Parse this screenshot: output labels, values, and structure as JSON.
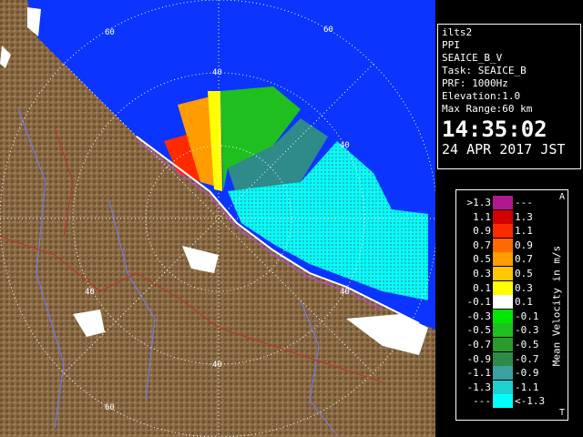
{
  "info": {
    "station": "ilts2",
    "mode": "PPI",
    "product": "SEAICE_B_V",
    "task": "Task: SEAICE_B",
    "prf": "PRF: 1000Hz",
    "elevation": "Elevation:1.0",
    "max_range": "Max Range:60 km",
    "time": "14:35:02",
    "date": "24 APR 2017 JST"
  },
  "range_labels": {
    "r60_top": "60",
    "r40_top": "40",
    "r40_right": "40",
    "r40_left": "40",
    "r40_bottom": "40",
    "r60_bottom": "60",
    "r40_lower_right": "40"
  },
  "legend": {
    "title": "Mean Velocity in m/s",
    "caret_top": "A",
    "caret_bottom": "T",
    "rows": [
      {
        "left": ">1.3",
        "right": "---",
        "color": "#b0188f"
      },
      {
        "left": "1.1",
        "right": "1.3",
        "color": "#d40000"
      },
      {
        "left": "0.9",
        "right": "1.1",
        "color": "#ff2a00"
      },
      {
        "left": "0.7",
        "right": "0.9",
        "color": "#ff6a00"
      },
      {
        "left": "0.5",
        "right": "0.7",
        "color": "#ff9c00"
      },
      {
        "left": "0.3",
        "right": "0.5",
        "color": "#ffc800"
      },
      {
        "left": "0.1",
        "right": "0.3",
        "color": "#ffff00"
      },
      {
        "left": "-0.1",
        "right": "0.1",
        "color": "#ffffff"
      },
      {
        "left": "-0.3",
        "right": "-0.1",
        "color": "#00e600"
      },
      {
        "left": "-0.5",
        "right": "-0.3",
        "color": "#1fbf1f"
      },
      {
        "left": "-0.7",
        "right": "-0.5",
        "color": "#2a9a2a"
      },
      {
        "left": "-0.9",
        "right": "-0.7",
        "color": "#2f8a4a"
      },
      {
        "left": "-1.1",
        "right": "-0.9",
        "color": "#3aa0a0"
      },
      {
        "left": "-1.3",
        "right": "-1.1",
        "color": "#1fd0d0"
      },
      {
        "left": "---",
        "right": "<-1.3",
        "color": "#00ffff"
      }
    ]
  },
  "colors": {
    "sea": "#0b34ff",
    "land": "#8a6a44",
    "echo_cyan": "#00ffff",
    "ring": "#ffffff"
  }
}
